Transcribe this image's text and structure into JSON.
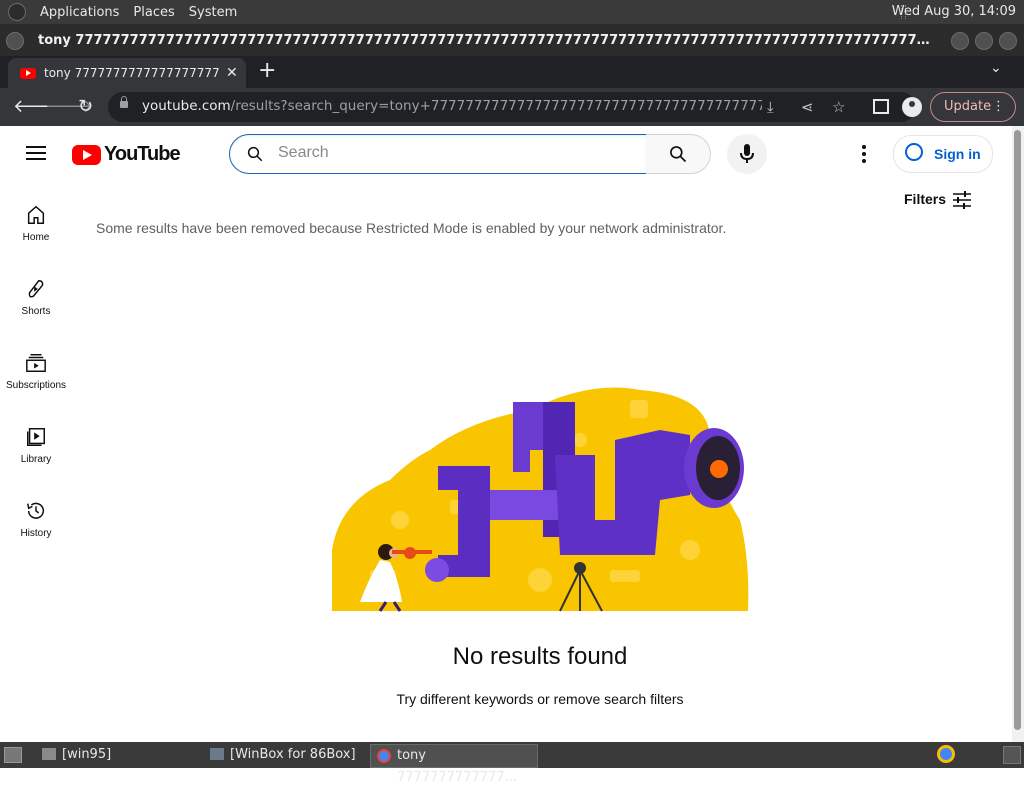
{
  "panel": {
    "menus": [
      "Applications",
      "Places",
      "System"
    ],
    "clock": "Wed Aug 30, 14:09"
  },
  "window": {
    "title": "tony 7777777777777777777777777777777777777777777777777777777777777777777777777777777777777777777777777777777..."
  },
  "browser": {
    "tab_title": "tony 7777777777777777777777777",
    "url_host": "youtube.com",
    "url_path": "/results?search_query=tony+7777777777777777777777777777777777777777777777...",
    "update_label": "Update"
  },
  "youtube": {
    "logo_text": "YouTube",
    "search_placeholder": "Search",
    "sign_in": "Sign in",
    "filters": "Filters",
    "guide": [
      {
        "label": "Home",
        "icon": "home-icon"
      },
      {
        "label": "Shorts",
        "icon": "shorts-icon"
      },
      {
        "label": "Subscriptions",
        "icon": "subscriptions-icon"
      },
      {
        "label": "Library",
        "icon": "library-icon"
      },
      {
        "label": "History",
        "icon": "history-icon"
      }
    ],
    "restricted_notice": "Some results have been removed because Restricted Mode is enabled by your network administrator.",
    "no_results": "No results found",
    "hint": "Try different keywords or remove search filters",
    "accent": "#ff0000",
    "link_color": "#065fd4"
  },
  "taskbar": {
    "items": [
      "[win95]",
      "[WinBox for 86Box]",
      "tony 7777777777777..."
    ]
  }
}
